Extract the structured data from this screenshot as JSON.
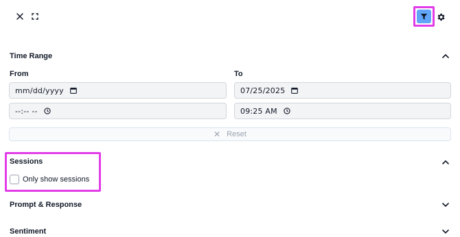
{
  "toolbar": {
    "close_icon": "close-icon",
    "expand_icon": "expand-icon",
    "filter_icon": "filter-icon",
    "settings_icon": "gear-icon"
  },
  "time_range": {
    "title": "Time Range",
    "from_label": "From",
    "to_label": "To",
    "from_date": "mm/dd/yyyy",
    "from_time": "--:-- --",
    "to_date": "07/25/2025",
    "to_time": "09:25 AM",
    "reset_label": "Reset",
    "expanded": true
  },
  "sessions": {
    "title": "Sessions",
    "checkbox_label": "Only show sessions",
    "checked": false,
    "expanded": true
  },
  "prompt_response": {
    "title": "Prompt & Response",
    "expanded": false
  },
  "sentiment": {
    "title": "Sentiment",
    "expanded": false
  },
  "colors": {
    "accent_highlight": "#e23ce8",
    "filter_button_bg": "#60a5fa",
    "field_bg": "#f3f4f6"
  }
}
